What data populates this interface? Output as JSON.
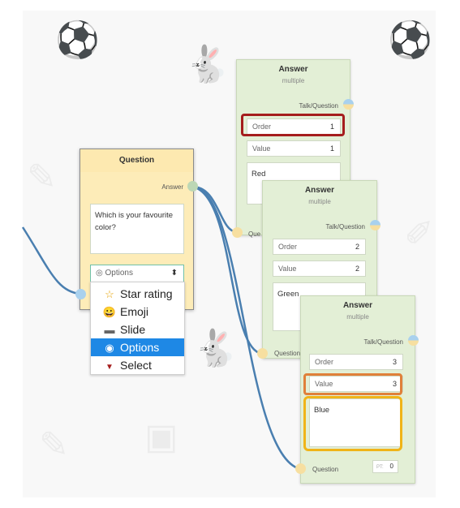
{
  "question_node": {
    "title": "Question",
    "answer_port": "Answer",
    "text": "Which is your favourite color?",
    "type_select": {
      "value": "Options",
      "caret": "⬍"
    },
    "options": [
      {
        "label": "Star rating",
        "icon": "star-icon",
        "glyph": "☆"
      },
      {
        "label": "Emoji",
        "icon": "emoji-icon",
        "glyph": "😀"
      },
      {
        "label": "Slide",
        "icon": "slide-icon",
        "glyph": "▬"
      },
      {
        "label": "Options",
        "icon": "radio-icon",
        "glyph": "◉",
        "selected": true
      },
      {
        "label": "Select",
        "icon": "caret-down-icon",
        "glyph": "▼"
      }
    ]
  },
  "answer_nodes": [
    {
      "title": "Answer",
      "subtitle": "multiple",
      "talk_port": "Talk/Question",
      "question_port": "Que",
      "order_label": "Order",
      "order": "1",
      "value_label": "Value",
      "value": "1",
      "text": "Red",
      "highlight_order_color": "#a51d1d"
    },
    {
      "title": "Answer",
      "subtitle": "multiple",
      "talk_port": "Talk/Question",
      "question_port": "Question",
      "order_label": "Order",
      "order": "2",
      "value_label": "Value",
      "value": "2",
      "text": "Green"
    },
    {
      "title": "Answer",
      "subtitle": "multiple",
      "talk_port": "Talk/Question",
      "question_port": "Question",
      "order_label": "Order",
      "order": "3",
      "value_label": "Value",
      "value": "3",
      "text": "Blue",
      "pt_label": "PT:",
      "pt_value": "0",
      "highlight_value_color": "#e0803a",
      "highlight_text_color": "#f0b418"
    }
  ],
  "colors": {
    "wire": "#4a7fb0",
    "answer_bg": "#e3efd6",
    "question_bg": "#fdecb8",
    "selected": "#1e88e5"
  }
}
